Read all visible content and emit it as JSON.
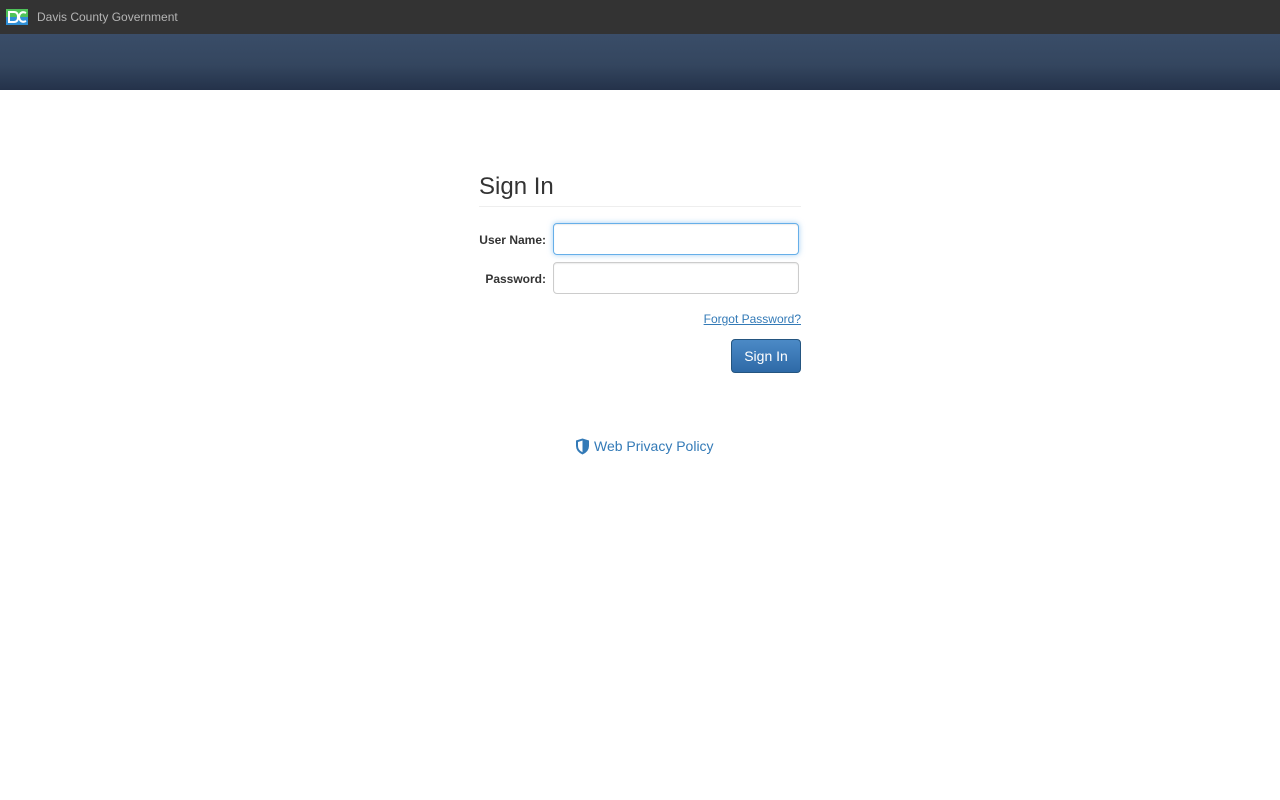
{
  "header": {
    "org_name": "Davis County Government",
    "logo_icon": "davis-county-logo",
    "background_color": "#333333",
    "banner_color": "#34465f"
  },
  "signin": {
    "title": "Sign In",
    "username_label": "User Name:",
    "username_value": "",
    "password_label": "Password:",
    "password_value": "",
    "forgot_password_label": "Forgot Password?",
    "submit_label": "Sign In",
    "accent_color": "#337ab7"
  },
  "footer": {
    "privacy_icon": "shield-icon",
    "privacy_label": "Web Privacy Policy"
  }
}
